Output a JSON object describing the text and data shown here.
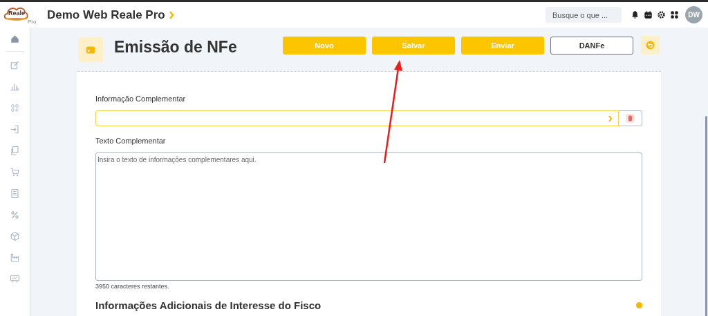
{
  "logo": {
    "name": "Reale",
    "sub": "Pro"
  },
  "app_title": "Demo Web Reale Pro",
  "search": {
    "placeholder": "Busque o que ..."
  },
  "avatar": "DW",
  "sidebar": {
    "items": [
      {
        "kind": "home",
        "selected": true
      },
      {
        "kind": "edit",
        "selected": false
      },
      {
        "kind": "chart",
        "selected": false
      },
      {
        "kind": "grid",
        "selected": false
      },
      {
        "kind": "login",
        "selected": false
      },
      {
        "kind": "copy",
        "selected": false
      },
      {
        "kind": "cart",
        "selected": false
      },
      {
        "kind": "calculator",
        "selected": false
      },
      {
        "kind": "percent",
        "selected": false
      },
      {
        "kind": "cube",
        "selected": false
      },
      {
        "kind": "factory",
        "selected": false
      },
      {
        "kind": "presentation",
        "selected": false
      }
    ]
  },
  "page": {
    "title": "Emissão de NFe",
    "buttons": [
      {
        "label": "Novo",
        "kind": "primary"
      },
      {
        "label": "Salvar",
        "kind": "primary"
      },
      {
        "label": "Enviar",
        "kind": "primary"
      },
      {
        "label": "DANFe",
        "kind": "outline"
      }
    ],
    "info_label": "Informação Complementar",
    "text_label": "Texto Complementar",
    "text_placeholder": "Insira o texto de informações complementares aqui.",
    "counter": "3950 caracteres restantes.",
    "next_section": "Informações Adicionais de Interesse do Fisco"
  }
}
